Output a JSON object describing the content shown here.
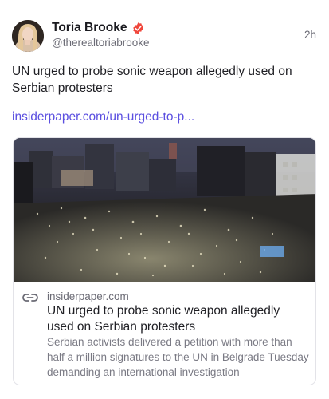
{
  "post": {
    "author": {
      "display_name": "Toria Brooke",
      "handle": "@therealtoriabrooke",
      "verified_icon": "verified-badge-icon",
      "avatar_icon": "avatar"
    },
    "timestamp": "2h",
    "text": "UN urged to probe sonic weapon allegedly used on Serbian protesters",
    "link_text": "insiderpaper.com/un-urged-to-p..."
  },
  "card": {
    "domain": "insiderpaper.com",
    "title": "UN urged to probe sonic weapon allegedly used on Serbian protesters",
    "description": "Serbian activists delivered a petition with more than half a million signatures to the UN in Belgrade Tuesday demanding an international investigation",
    "link_icon": "link-icon",
    "image_subject": "night crowd photo"
  },
  "colors": {
    "link": "#5b4fe0",
    "verified_badge": "#f0473c",
    "secondary_text": "#6b6b75"
  }
}
